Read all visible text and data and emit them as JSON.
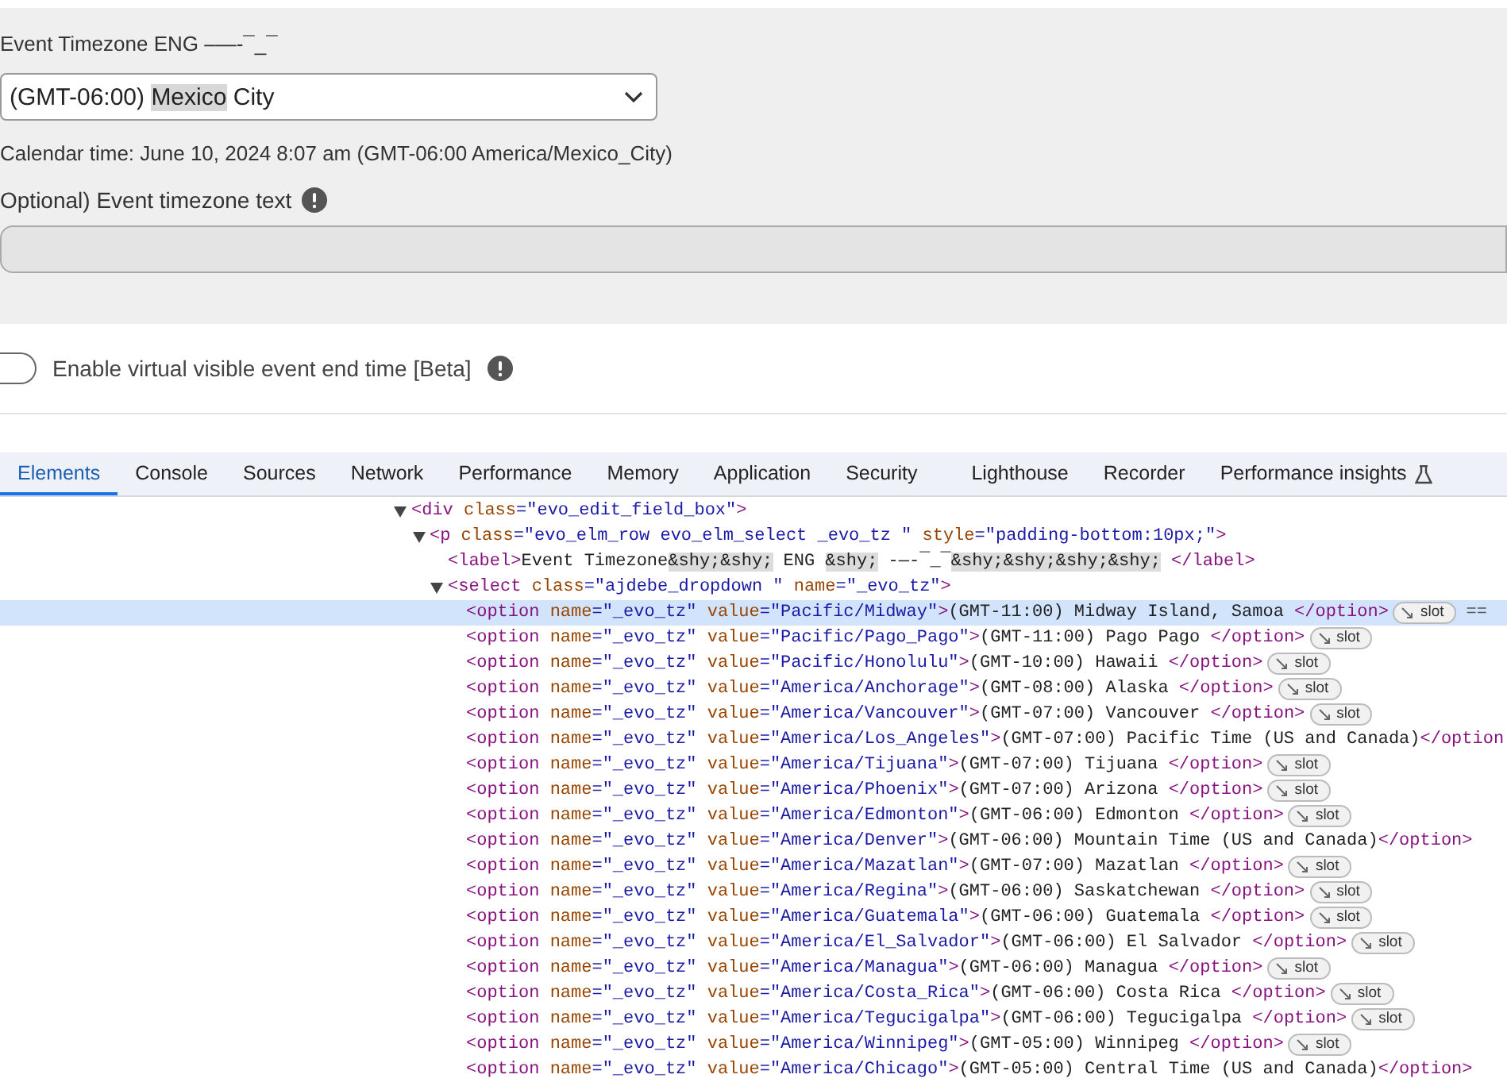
{
  "form": {
    "timezone_label": "Event Timezone ENG  –—-¯_¯",
    "timezone_select": {
      "value_parts": [
        {
          "s": "(GMT-06:00) ",
          "highlighted": false
        },
        {
          "s": "Mexico",
          "highlighted": true
        },
        {
          "s": " City",
          "highlighted": false
        }
      ]
    },
    "calendar_time": "Calendar time: June 10, 2024 8:07 am (GMT-06:00 America/Mexico_City)",
    "timezone_text_label": "Optional) Event timezone text",
    "timezone_text_field": {
      "disabled": true
    },
    "end_time_toggle": {
      "label": "Enable virtual visible event end time [Beta]",
      "on": false
    }
  },
  "devtools": {
    "tabs": [
      {
        "label": "Elements",
        "selected": true
      },
      {
        "label": "Console",
        "selected": false
      },
      {
        "label": "Sources",
        "selected": false
      },
      {
        "label": "Network",
        "selected": false
      },
      {
        "label": "Performance",
        "selected": false
      },
      {
        "label": "Memory",
        "selected": false
      },
      {
        "label": "Application",
        "selected": false
      },
      {
        "label": "Security",
        "selected": false
      },
      {
        "label": "Lighthouse",
        "selected": false
      },
      {
        "label": "Recorder",
        "selected": false
      },
      {
        "label": "Performance insights",
        "selected": false
      }
    ],
    "dom": [
      {
        "segments": [
          {
            "kind": "tag",
            "s": "<div"
          },
          {
            "kind": "attr",
            "s": " class"
          },
          {
            "kind": "val",
            "s": "=\"evo_edit_field_box\""
          },
          {
            "kind": "tag",
            "s": ">"
          }
        ],
        "expanded": true,
        "children": [
          {
            "segments": [
              {
                "kind": "tag",
                "s": "<p"
              },
              {
                "kind": "attr",
                "s": " class"
              },
              {
                "kind": "val",
                "s": "=\"evo_elm_row evo_elm_select _evo_tz \""
              },
              {
                "kind": "attr",
                "s": " style"
              },
              {
                "kind": "val",
                "s": "=\"padding-bottom:10px;\""
              },
              {
                "kind": "tag",
                "s": ">"
              }
            ],
            "expanded": true,
            "children": [
              {
                "segments": [
                  {
                    "kind": "tag",
                    "s": "<label>"
                  },
                  {
                    "kind": "text",
                    "s": "Event Timezone"
                  },
                  {
                    "kind": "entity",
                    "s": "&shy;&shy;"
                  },
                  {
                    "kind": "text",
                    "s": " ENG "
                  },
                  {
                    "kind": "entity",
                    "s": "&shy;"
                  },
                  {
                    "kind": "text",
                    "s": " -—-¯_¯"
                  },
                  {
                    "kind": "entity",
                    "s": "&shy;&shy;&shy;&shy;"
                  },
                  {
                    "kind": "tag",
                    "s": " </label>"
                  }
                ]
              },
              {
                "segments": [
                  {
                    "kind": "tag",
                    "s": "<select"
                  },
                  {
                    "kind": "attr",
                    "s": " class"
                  },
                  {
                    "kind": "val",
                    "s": "=\"ajdebe_dropdown \""
                  },
                  {
                    "kind": "attr",
                    "s": " name"
                  },
                  {
                    "kind": "val",
                    "s": "=\"_evo_tz\""
                  },
                  {
                    "kind": "tag",
                    "s": ">"
                  }
                ],
                "expanded": true,
                "children": [
                  {
                    "segments": [
                      {
                        "kind": "tag",
                        "s": "<option"
                      },
                      {
                        "kind": "attr",
                        "s": " name"
                      },
                      {
                        "kind": "val",
                        "s": "=\"_evo_tz\""
                      },
                      {
                        "kind": "attr",
                        "s": " value"
                      },
                      {
                        "kind": "val",
                        "s": "=\"Pacific/Midway\""
                      },
                      {
                        "kind": "tag",
                        "s": ">"
                      },
                      {
                        "kind": "text",
                        "s": "(GMT-11:00) Midway Island, Samoa "
                      },
                      {
                        "kind": "tag",
                        "s": "</option>"
                      }
                    ],
                    "badge": "slot",
                    "after": "==",
                    "selected": true
                  },
                  {
                    "segments": [
                      {
                        "kind": "tag",
                        "s": "<option"
                      },
                      {
                        "kind": "attr",
                        "s": " name"
                      },
                      {
                        "kind": "val",
                        "s": "=\"_evo_tz\""
                      },
                      {
                        "kind": "attr",
                        "s": " value"
                      },
                      {
                        "kind": "val",
                        "s": "=\"Pacific/Pago_Pago\""
                      },
                      {
                        "kind": "tag",
                        "s": ">"
                      },
                      {
                        "kind": "text",
                        "s": "(GMT-11:00) Pago Pago "
                      },
                      {
                        "kind": "tag",
                        "s": "</option>"
                      }
                    ],
                    "badge": "slot",
                    "selected": false
                  },
                  {
                    "segments": [
                      {
                        "kind": "tag",
                        "s": "<option"
                      },
                      {
                        "kind": "attr",
                        "s": " name"
                      },
                      {
                        "kind": "val",
                        "s": "=\"_evo_tz\""
                      },
                      {
                        "kind": "attr",
                        "s": " value"
                      },
                      {
                        "kind": "val",
                        "s": "=\"Pacific/Honolulu\""
                      },
                      {
                        "kind": "tag",
                        "s": ">"
                      },
                      {
                        "kind": "text",
                        "s": "(GMT-10:00) Hawaii "
                      },
                      {
                        "kind": "tag",
                        "s": "</option>"
                      }
                    ],
                    "badge": "slot",
                    "selected": false
                  },
                  {
                    "segments": [
                      {
                        "kind": "tag",
                        "s": "<option"
                      },
                      {
                        "kind": "attr",
                        "s": " name"
                      },
                      {
                        "kind": "val",
                        "s": "=\"_evo_tz\""
                      },
                      {
                        "kind": "attr",
                        "s": " value"
                      },
                      {
                        "kind": "val",
                        "s": "=\"America/Anchorage\""
                      },
                      {
                        "kind": "tag",
                        "s": ">"
                      },
                      {
                        "kind": "text",
                        "s": "(GMT-08:00) Alaska "
                      },
                      {
                        "kind": "tag",
                        "s": "</option>"
                      }
                    ],
                    "badge": "slot",
                    "selected": false
                  },
                  {
                    "segments": [
                      {
                        "kind": "tag",
                        "s": "<option"
                      },
                      {
                        "kind": "attr",
                        "s": " name"
                      },
                      {
                        "kind": "val",
                        "s": "=\"_evo_tz\""
                      },
                      {
                        "kind": "attr",
                        "s": " value"
                      },
                      {
                        "kind": "val",
                        "s": "=\"America/Vancouver\""
                      },
                      {
                        "kind": "tag",
                        "s": ">"
                      },
                      {
                        "kind": "text",
                        "s": "(GMT-07:00) Vancouver "
                      },
                      {
                        "kind": "tag",
                        "s": "</option>"
                      }
                    ],
                    "badge": "slot",
                    "selected": false
                  },
                  {
                    "segments": [
                      {
                        "kind": "tag",
                        "s": "<option"
                      },
                      {
                        "kind": "attr",
                        "s": " name"
                      },
                      {
                        "kind": "val",
                        "s": "=\"_evo_tz\""
                      },
                      {
                        "kind": "attr",
                        "s": " value"
                      },
                      {
                        "kind": "val",
                        "s": "=\"America/Los_Angeles\""
                      },
                      {
                        "kind": "tag",
                        "s": ">"
                      },
                      {
                        "kind": "text",
                        "s": "(GMT-07:00) Pacific Time (US and Canada)"
                      },
                      {
                        "kind": "tag",
                        "s": "</option"
                      }
                    ],
                    "selected": false
                  },
                  {
                    "segments": [
                      {
                        "kind": "tag",
                        "s": "<option"
                      },
                      {
                        "kind": "attr",
                        "s": " name"
                      },
                      {
                        "kind": "val",
                        "s": "=\"_evo_tz\""
                      },
                      {
                        "kind": "attr",
                        "s": " value"
                      },
                      {
                        "kind": "val",
                        "s": "=\"America/Tijuana\""
                      },
                      {
                        "kind": "tag",
                        "s": ">"
                      },
                      {
                        "kind": "text",
                        "s": "(GMT-07:00) Tijuana "
                      },
                      {
                        "kind": "tag",
                        "s": "</option>"
                      }
                    ],
                    "badge": "slot",
                    "selected": false
                  },
                  {
                    "segments": [
                      {
                        "kind": "tag",
                        "s": "<option"
                      },
                      {
                        "kind": "attr",
                        "s": " name"
                      },
                      {
                        "kind": "val",
                        "s": "=\"_evo_tz\""
                      },
                      {
                        "kind": "attr",
                        "s": " value"
                      },
                      {
                        "kind": "val",
                        "s": "=\"America/Phoenix\""
                      },
                      {
                        "kind": "tag",
                        "s": ">"
                      },
                      {
                        "kind": "text",
                        "s": "(GMT-07:00) Arizona "
                      },
                      {
                        "kind": "tag",
                        "s": "</option>"
                      }
                    ],
                    "badge": "slot",
                    "selected": false
                  },
                  {
                    "segments": [
                      {
                        "kind": "tag",
                        "s": "<option"
                      },
                      {
                        "kind": "attr",
                        "s": " name"
                      },
                      {
                        "kind": "val",
                        "s": "=\"_evo_tz\""
                      },
                      {
                        "kind": "attr",
                        "s": " value"
                      },
                      {
                        "kind": "val",
                        "s": "=\"America/Edmonton\""
                      },
                      {
                        "kind": "tag",
                        "s": ">"
                      },
                      {
                        "kind": "text",
                        "s": "(GMT-06:00) Edmonton "
                      },
                      {
                        "kind": "tag",
                        "s": "</option>"
                      }
                    ],
                    "badge": "slot",
                    "selected": false
                  },
                  {
                    "segments": [
                      {
                        "kind": "tag",
                        "s": "<option"
                      },
                      {
                        "kind": "attr",
                        "s": " name"
                      },
                      {
                        "kind": "val",
                        "s": "=\"_evo_tz\""
                      },
                      {
                        "kind": "attr",
                        "s": " value"
                      },
                      {
                        "kind": "val",
                        "s": "=\"America/Denver\""
                      },
                      {
                        "kind": "tag",
                        "s": ">"
                      },
                      {
                        "kind": "text",
                        "s": "(GMT-06:00) Mountain Time (US and Canada)"
                      },
                      {
                        "kind": "tag",
                        "s": "</option>"
                      }
                    ],
                    "selected": false
                  },
                  {
                    "segments": [
                      {
                        "kind": "tag",
                        "s": "<option"
                      },
                      {
                        "kind": "attr",
                        "s": " name"
                      },
                      {
                        "kind": "val",
                        "s": "=\"_evo_tz\""
                      },
                      {
                        "kind": "attr",
                        "s": " value"
                      },
                      {
                        "kind": "val",
                        "s": "=\"America/Mazatlan\""
                      },
                      {
                        "kind": "tag",
                        "s": ">"
                      },
                      {
                        "kind": "text",
                        "s": "(GMT-07:00) Mazatlan "
                      },
                      {
                        "kind": "tag",
                        "s": "</option>"
                      }
                    ],
                    "badge": "slot",
                    "selected": false
                  },
                  {
                    "segments": [
                      {
                        "kind": "tag",
                        "s": "<option"
                      },
                      {
                        "kind": "attr",
                        "s": " name"
                      },
                      {
                        "kind": "val",
                        "s": "=\"_evo_tz\""
                      },
                      {
                        "kind": "attr",
                        "s": " value"
                      },
                      {
                        "kind": "val",
                        "s": "=\"America/Regina\""
                      },
                      {
                        "kind": "tag",
                        "s": ">"
                      },
                      {
                        "kind": "text",
                        "s": "(GMT-06:00) Saskatchewan "
                      },
                      {
                        "kind": "tag",
                        "s": "</option>"
                      }
                    ],
                    "badge": "slot",
                    "selected": false
                  },
                  {
                    "segments": [
                      {
                        "kind": "tag",
                        "s": "<option"
                      },
                      {
                        "kind": "attr",
                        "s": " name"
                      },
                      {
                        "kind": "val",
                        "s": "=\"_evo_tz\""
                      },
                      {
                        "kind": "attr",
                        "s": " value"
                      },
                      {
                        "kind": "val",
                        "s": "=\"America/Guatemala\""
                      },
                      {
                        "kind": "tag",
                        "s": ">"
                      },
                      {
                        "kind": "text",
                        "s": "(GMT-06:00) Guatemala "
                      },
                      {
                        "kind": "tag",
                        "s": "</option>"
                      }
                    ],
                    "badge": "slot",
                    "selected": false
                  },
                  {
                    "segments": [
                      {
                        "kind": "tag",
                        "s": "<option"
                      },
                      {
                        "kind": "attr",
                        "s": " name"
                      },
                      {
                        "kind": "val",
                        "s": "=\"_evo_tz\""
                      },
                      {
                        "kind": "attr",
                        "s": " value"
                      },
                      {
                        "kind": "val",
                        "s": "=\"America/El_Salvador\""
                      },
                      {
                        "kind": "tag",
                        "s": ">"
                      },
                      {
                        "kind": "text",
                        "s": "(GMT-06:00) El Salvador "
                      },
                      {
                        "kind": "tag",
                        "s": "</option>"
                      }
                    ],
                    "badge": "slot",
                    "selected": false
                  },
                  {
                    "segments": [
                      {
                        "kind": "tag",
                        "s": "<option"
                      },
                      {
                        "kind": "attr",
                        "s": " name"
                      },
                      {
                        "kind": "val",
                        "s": "=\"_evo_tz\""
                      },
                      {
                        "kind": "attr",
                        "s": " value"
                      },
                      {
                        "kind": "val",
                        "s": "=\"America/Managua\""
                      },
                      {
                        "kind": "tag",
                        "s": ">"
                      },
                      {
                        "kind": "text",
                        "s": "(GMT-06:00) Managua "
                      },
                      {
                        "kind": "tag",
                        "s": "</option>"
                      }
                    ],
                    "badge": "slot",
                    "selected": false
                  },
                  {
                    "segments": [
                      {
                        "kind": "tag",
                        "s": "<option"
                      },
                      {
                        "kind": "attr",
                        "s": " name"
                      },
                      {
                        "kind": "val",
                        "s": "=\"_evo_tz\""
                      },
                      {
                        "kind": "attr",
                        "s": " value"
                      },
                      {
                        "kind": "val",
                        "s": "=\"America/Costa_Rica\""
                      },
                      {
                        "kind": "tag",
                        "s": ">"
                      },
                      {
                        "kind": "text",
                        "s": "(GMT-06:00) Costa Rica "
                      },
                      {
                        "kind": "tag",
                        "s": "</option>"
                      }
                    ],
                    "badge": "slot",
                    "selected": false
                  },
                  {
                    "segments": [
                      {
                        "kind": "tag",
                        "s": "<option"
                      },
                      {
                        "kind": "attr",
                        "s": " name"
                      },
                      {
                        "kind": "val",
                        "s": "=\"_evo_tz\""
                      },
                      {
                        "kind": "attr",
                        "s": " value"
                      },
                      {
                        "kind": "val",
                        "s": "=\"America/Tegucigalpa\""
                      },
                      {
                        "kind": "tag",
                        "s": ">"
                      },
                      {
                        "kind": "text",
                        "s": "(GMT-06:00) Tegucigalpa "
                      },
                      {
                        "kind": "tag",
                        "s": "</option>"
                      }
                    ],
                    "badge": "slot",
                    "selected": false
                  },
                  {
                    "segments": [
                      {
                        "kind": "tag",
                        "s": "<option"
                      },
                      {
                        "kind": "attr",
                        "s": " name"
                      },
                      {
                        "kind": "val",
                        "s": "=\"_evo_tz\""
                      },
                      {
                        "kind": "attr",
                        "s": " value"
                      },
                      {
                        "kind": "val",
                        "s": "=\"America/Winnipeg\""
                      },
                      {
                        "kind": "tag",
                        "s": ">"
                      },
                      {
                        "kind": "text",
                        "s": "(GMT-05:00) Winnipeg "
                      },
                      {
                        "kind": "tag",
                        "s": "</option>"
                      }
                    ],
                    "badge": "slot",
                    "selected": false
                  },
                  {
                    "segments": [
                      {
                        "kind": "tag",
                        "s": "<option"
                      },
                      {
                        "kind": "attr",
                        "s": " name"
                      },
                      {
                        "kind": "val",
                        "s": "=\"_evo_tz\""
                      },
                      {
                        "kind": "attr",
                        "s": " value"
                      },
                      {
                        "kind": "val",
                        "s": "=\"America/Chicago\""
                      },
                      {
                        "kind": "tag",
                        "s": ">"
                      },
                      {
                        "kind": "text",
                        "s": "(GMT-05:00) Central Time (US and Canada)"
                      },
                      {
                        "kind": "tag",
                        "s": "</option>"
                      }
                    ],
                    "selected": false
                  }
                ]
              }
            ]
          }
        ]
      }
    ]
  }
}
